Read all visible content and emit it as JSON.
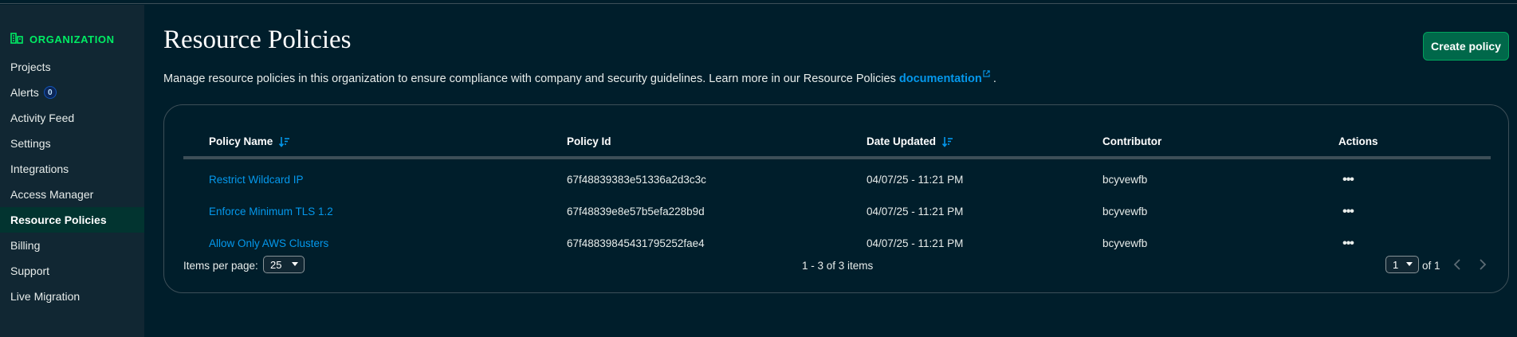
{
  "sidebar": {
    "header": "ORGANIZATION",
    "items": [
      {
        "label": "Projects"
      },
      {
        "label": "Alerts",
        "badge": "0"
      },
      {
        "label": "Activity Feed"
      },
      {
        "label": "Settings"
      },
      {
        "label": "Integrations"
      },
      {
        "label": "Access Manager"
      },
      {
        "label": "Resource Policies",
        "active": true
      },
      {
        "label": "Billing"
      },
      {
        "label": "Support"
      },
      {
        "label": "Live Migration"
      }
    ]
  },
  "main": {
    "title": "Resource Policies",
    "create_button": "Create policy",
    "description_text": "Manage resource policies in this organization to ensure compliance with company and security guidelines. Learn more in our Resource Policies",
    "description_link": "documentation",
    "description_end": "."
  },
  "table": {
    "headers": {
      "policy_name": "Policy Name",
      "policy_id": "Policy Id",
      "date_updated": "Date Updated",
      "contributor": "Contributor",
      "actions": "Actions"
    },
    "rows": [
      {
        "name": "Restrict Wildcard IP",
        "id": "67f48839383e51336a2d3c3c",
        "date": "04/07/25 - 11:21 PM",
        "contributor": "bcyvewfb"
      },
      {
        "name": "Enforce Minimum TLS 1.2",
        "id": "67f48839e8e57b5efa228b9d",
        "date": "04/07/25 - 11:21 PM",
        "contributor": "bcyvewfb"
      },
      {
        "name": "Allow Only AWS Clusters",
        "id": "67f48839845431795252fae4",
        "date": "04/07/25 - 11:21 PM",
        "contributor": "bcyvewfb"
      }
    ],
    "footer": {
      "items_per_page_label": "Items per page:",
      "items_per_page": "25",
      "range": "1 - 3 of 3 items",
      "page": "1",
      "of_pages": "of 1"
    }
  },
  "colors": {
    "background": "#001e2b",
    "sidebar": "#112733",
    "accent_green": "#00ed64",
    "link_blue": "#0498ec",
    "button_green": "#00684a"
  },
  "icons": {
    "org": "building-icon",
    "sort": "sort-descending-icon",
    "external": "external-link-icon",
    "more": "ellipsis-icon",
    "prev": "chevron-left-icon",
    "next": "chevron-right-icon"
  }
}
